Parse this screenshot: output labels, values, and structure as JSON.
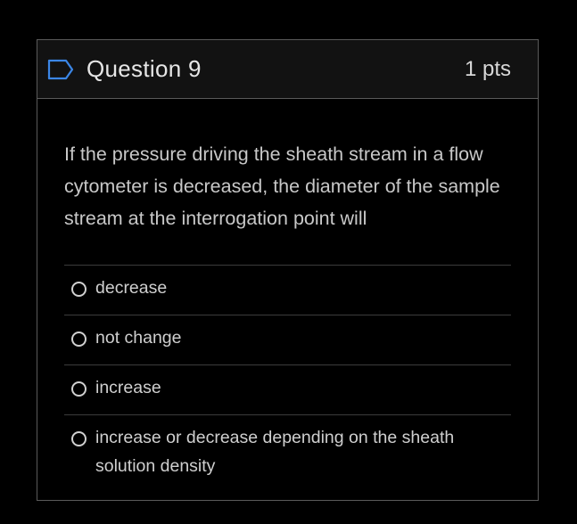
{
  "question": {
    "title": "Question 9",
    "points": "1 pts",
    "text": "If the pressure driving the sheath stream in a flow cytometer is decreased, the diameter of the sample stream at the interrogation point will",
    "flag_icon": "flag-outline-icon",
    "accent_color": "#3b86e6"
  },
  "answers": [
    {
      "label": "decrease",
      "selected": false
    },
    {
      "label": "not change",
      "selected": false
    },
    {
      "label": "increase",
      "selected": false
    },
    {
      "label": "increase or decrease depending on the sheath solution density",
      "selected": false
    }
  ]
}
